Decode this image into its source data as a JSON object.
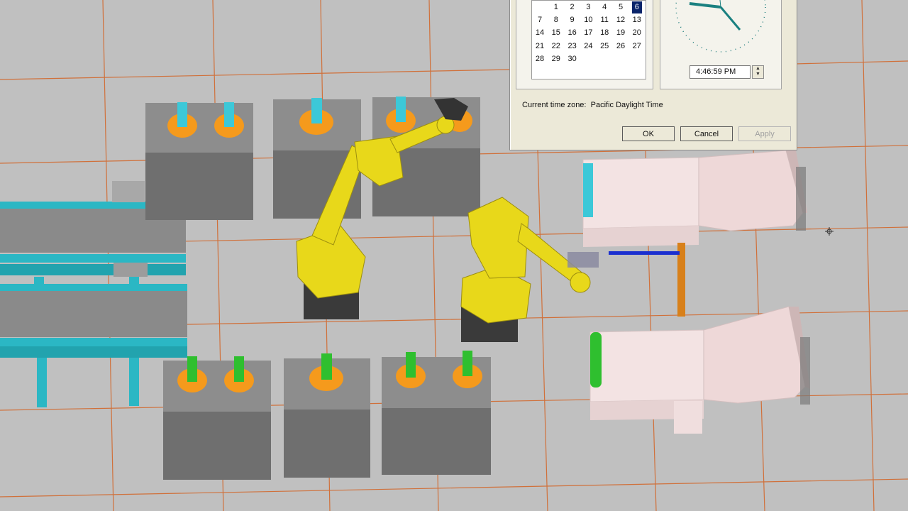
{
  "dialog": {
    "calendar_days": [
      {
        "d": "1",
        "c": 1,
        "r": 0
      },
      {
        "d": "2",
        "c": 2,
        "r": 0
      },
      {
        "d": "3",
        "c": 3,
        "r": 0
      },
      {
        "d": "4",
        "c": 4,
        "r": 0
      },
      {
        "d": "5",
        "c": 5,
        "r": 0
      },
      {
        "d": "6",
        "c": 6,
        "r": 0,
        "selected": true
      },
      {
        "d": "7",
        "c": 0,
        "r": 1
      },
      {
        "d": "8",
        "c": 1,
        "r": 1
      },
      {
        "d": "9",
        "c": 2,
        "r": 1
      },
      {
        "d": "10",
        "c": 3,
        "r": 1
      },
      {
        "d": "11",
        "c": 4,
        "r": 1
      },
      {
        "d": "12",
        "c": 5,
        "r": 1
      },
      {
        "d": "13",
        "c": 6,
        "r": 1
      },
      {
        "d": "14",
        "c": 0,
        "r": 2
      },
      {
        "d": "15",
        "c": 1,
        "r": 2
      },
      {
        "d": "16",
        "c": 2,
        "r": 2
      },
      {
        "d": "17",
        "c": 3,
        "r": 2
      },
      {
        "d": "18",
        "c": 4,
        "r": 2
      },
      {
        "d": "19",
        "c": 5,
        "r": 2
      },
      {
        "d": "20",
        "c": 6,
        "r": 2
      },
      {
        "d": "21",
        "c": 0,
        "r": 3
      },
      {
        "d": "22",
        "c": 1,
        "r": 3
      },
      {
        "d": "23",
        "c": 2,
        "r": 3
      },
      {
        "d": "24",
        "c": 3,
        "r": 3
      },
      {
        "d": "25",
        "c": 4,
        "r": 3
      },
      {
        "d": "26",
        "c": 5,
        "r": 3
      },
      {
        "d": "27",
        "c": 6,
        "r": 3
      },
      {
        "d": "28",
        "c": 0,
        "r": 4
      },
      {
        "d": "29",
        "c": 1,
        "r": 4
      },
      {
        "d": "30",
        "c": 2,
        "r": 4
      }
    ],
    "time_value": "4:46:59 PM",
    "timezone_label": "Current time zone:",
    "timezone_value": "Pacific Daylight Time",
    "ok_label": "OK",
    "cancel_label": "Cancel",
    "apply_label": "Apply"
  },
  "colors": {
    "floor": "#bfbfbf",
    "grid_line": "#d2703a",
    "pedestal_top": "#8f8f8f",
    "pedestal_side": "#6f6f6f",
    "orange_disc": "#f59a1c",
    "cyan_part": "#3cc8d8",
    "green_part": "#2fbf2f",
    "robot_yellow": "#e8d81a",
    "robot_base": "#3a3a3a",
    "conveyor": "#2bb7c4",
    "machine": "#f0dcdc"
  }
}
